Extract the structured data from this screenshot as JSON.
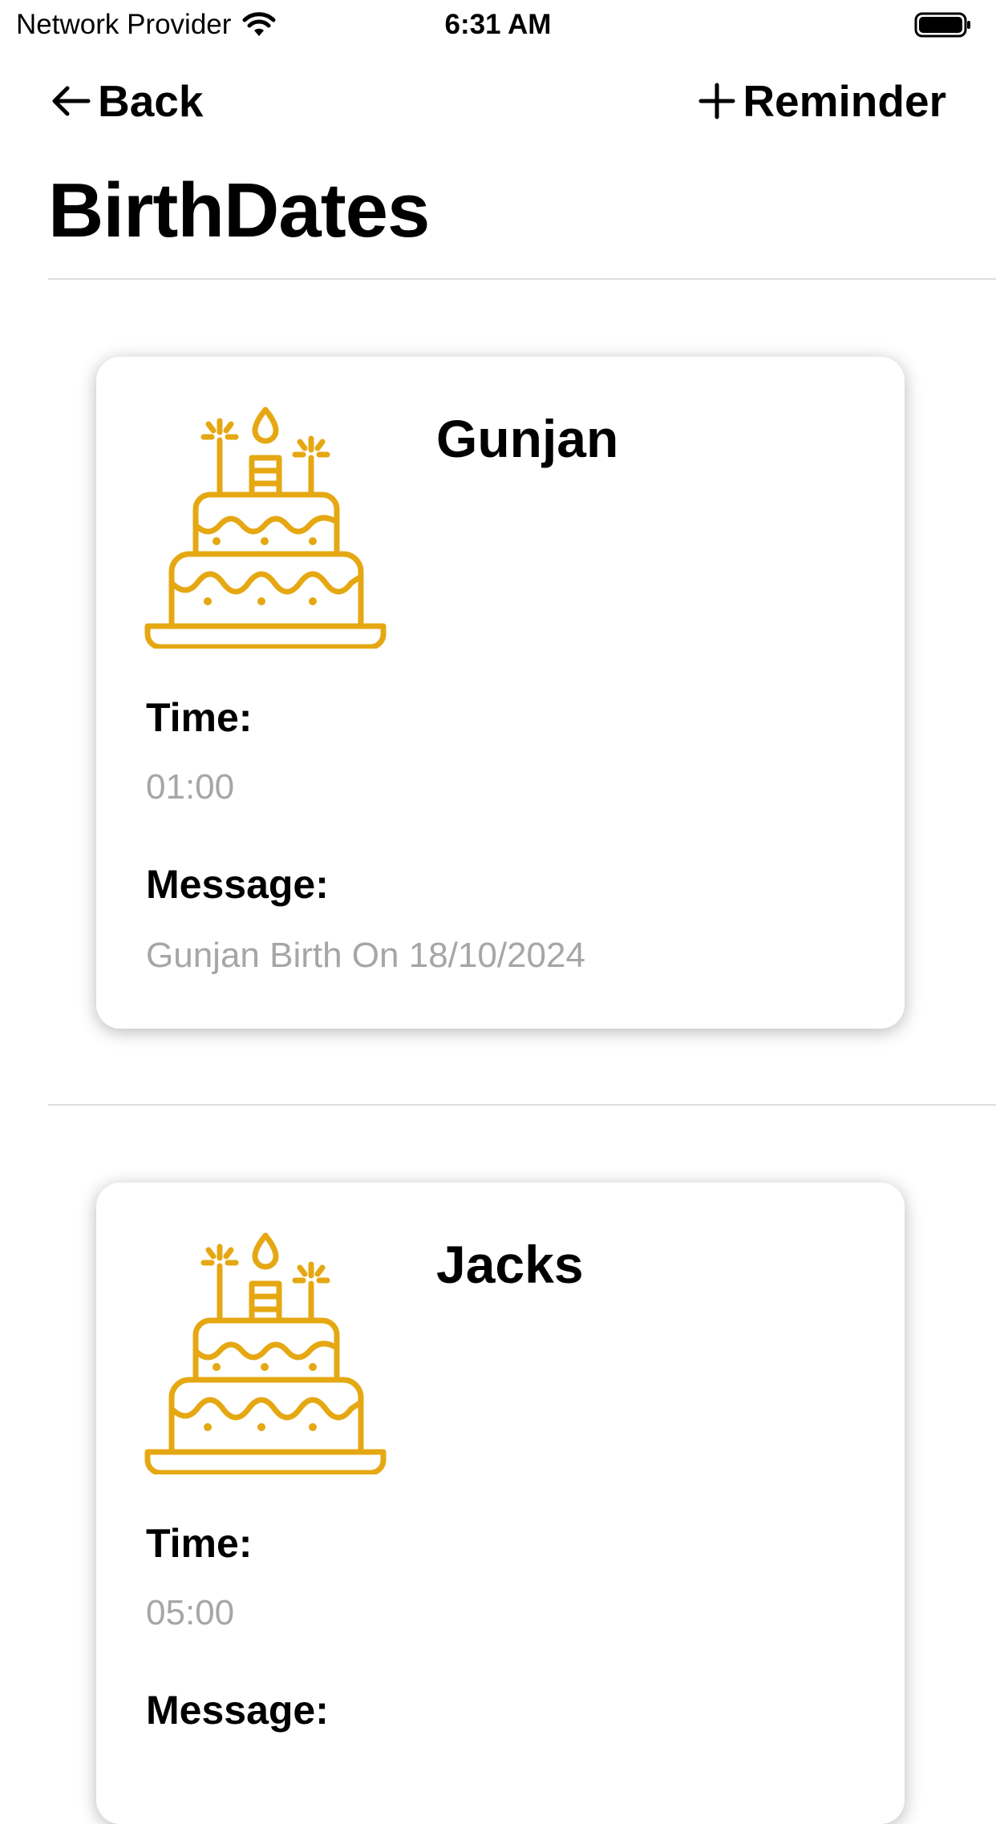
{
  "status_bar": {
    "carrier": "Network Provider",
    "time": "6:31 AM"
  },
  "nav": {
    "back_label": "Back",
    "add_label": "Reminder"
  },
  "page": {
    "title": "BirthDates"
  },
  "reminders": [
    {
      "name": "Gunjan",
      "time_label": "Time:",
      "time_value": "01:00",
      "message_label": "Message:",
      "message_value": "Gunjan Birth On 18/10/2024"
    },
    {
      "name": "Jacks",
      "time_label": "Time:",
      "time_value": "05:00",
      "message_label": "Message:",
      "message_value": ""
    }
  ],
  "colors": {
    "accent": "#E5A813",
    "value_text": "#A6A6A6",
    "divider": "#DEDEDE"
  },
  "icons": {
    "cake": "birthday-cake-icon",
    "back": "arrow-left-icon",
    "add": "plus-icon"
  }
}
